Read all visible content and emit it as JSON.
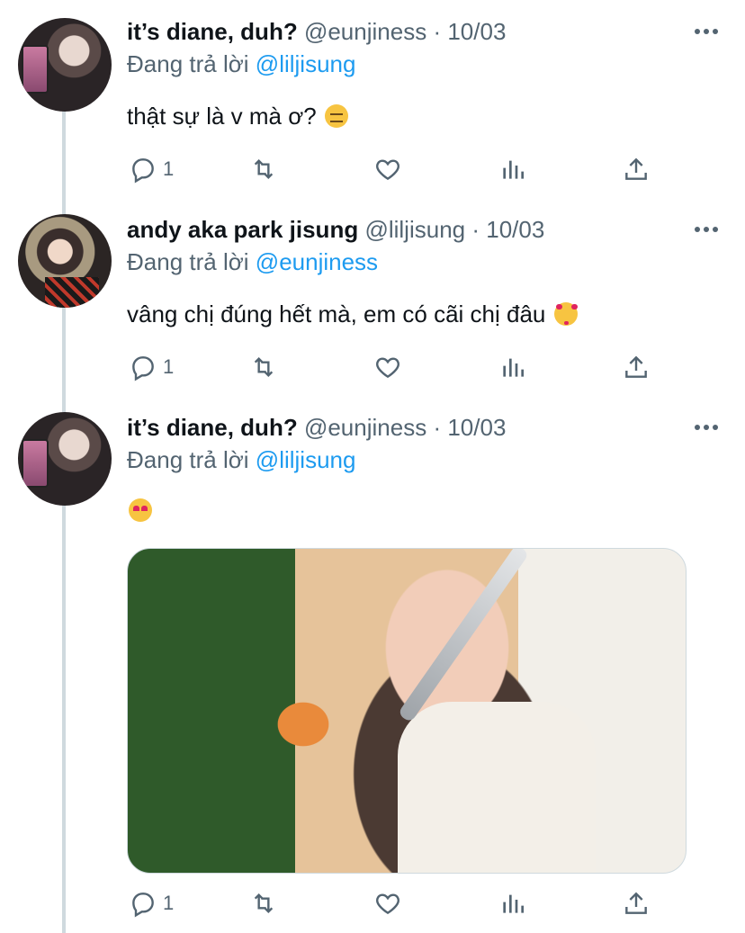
{
  "tweets": [
    {
      "name": "it’s diane, duh?",
      "handle": "@eunjiness",
      "sep": "·",
      "date": "10/03",
      "reply_prefix": "Đang trả lời",
      "reply_to": "@liljisung",
      "text": "thật sự là v mà ơ?",
      "emoji": "unamused-face",
      "reply_count": "1"
    },
    {
      "name": "andy aka park jisung",
      "handle": "@liljisung",
      "sep": "·",
      "date": "10/03",
      "reply_prefix": "Đang trả lời",
      "reply_to": "@eunjiness",
      "text": "vâng chị đúng hết mà, em có cãi chị đâu",
      "emoji": "smiling-face-with-hearts",
      "reply_count": "1"
    },
    {
      "name": "it’s diane, duh?",
      "handle": "@eunjiness",
      "sep": "·",
      "date": "10/03",
      "reply_prefix": "Đang trả lời",
      "reply_to": "@liljisung",
      "text": "",
      "emoji": "heart-eyes-face",
      "reply_count": "1",
      "has_media": true
    }
  ],
  "icons": {
    "reply": "reply-icon",
    "retweet": "retweet-icon",
    "like": "like-icon",
    "analytics": "analytics-icon",
    "share": "share-icon",
    "more": "more-icon"
  },
  "colors": {
    "link": "#1d9bf0",
    "muted": "#536471",
    "thread_line": "#cfd9de"
  }
}
